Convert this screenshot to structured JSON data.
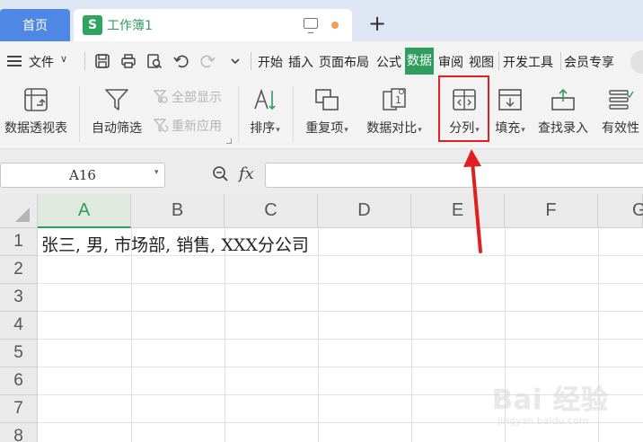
{
  "tabs": {
    "home_label": "首页",
    "workbook_icon": "S",
    "workbook_label": "工作簿1",
    "new_tab": "+"
  },
  "menu": {
    "file_label": "文件",
    "items": [
      "开始",
      "插入",
      "页面布局",
      "公式",
      "数据",
      "审阅",
      "视图",
      "开发工具",
      "会员专享"
    ],
    "active": "数据"
  },
  "ribbon": {
    "pivot": "数据透视表",
    "autofilter": "自动筛选",
    "show_all": "全部显示",
    "reapply": "重新应用",
    "sort": "排序",
    "duplicates": "重复项",
    "compare": "数据对比",
    "split": "分列",
    "fill": "填充",
    "lookup": "查找录入",
    "validity": "有效性"
  },
  "formula_bar": {
    "name_box": "A16",
    "fx": "fx",
    "formula": ""
  },
  "grid": {
    "columns": [
      "A",
      "B",
      "C",
      "D",
      "E",
      "F",
      "G"
    ],
    "rows": [
      "1",
      "2",
      "3",
      "4",
      "5",
      "6",
      "7",
      "8"
    ],
    "active_column": "A",
    "cells": {
      "A1": "张三, 男, 市场部, 销售, XXX分公司"
    }
  },
  "colors": {
    "accent_green": "#2f9e5c",
    "home_tab_blue": "#4e88e4",
    "annotation_red": "#e02020"
  },
  "watermark": {
    "main": "Bai 经验",
    "sub": "jingyan.baidu.com"
  }
}
